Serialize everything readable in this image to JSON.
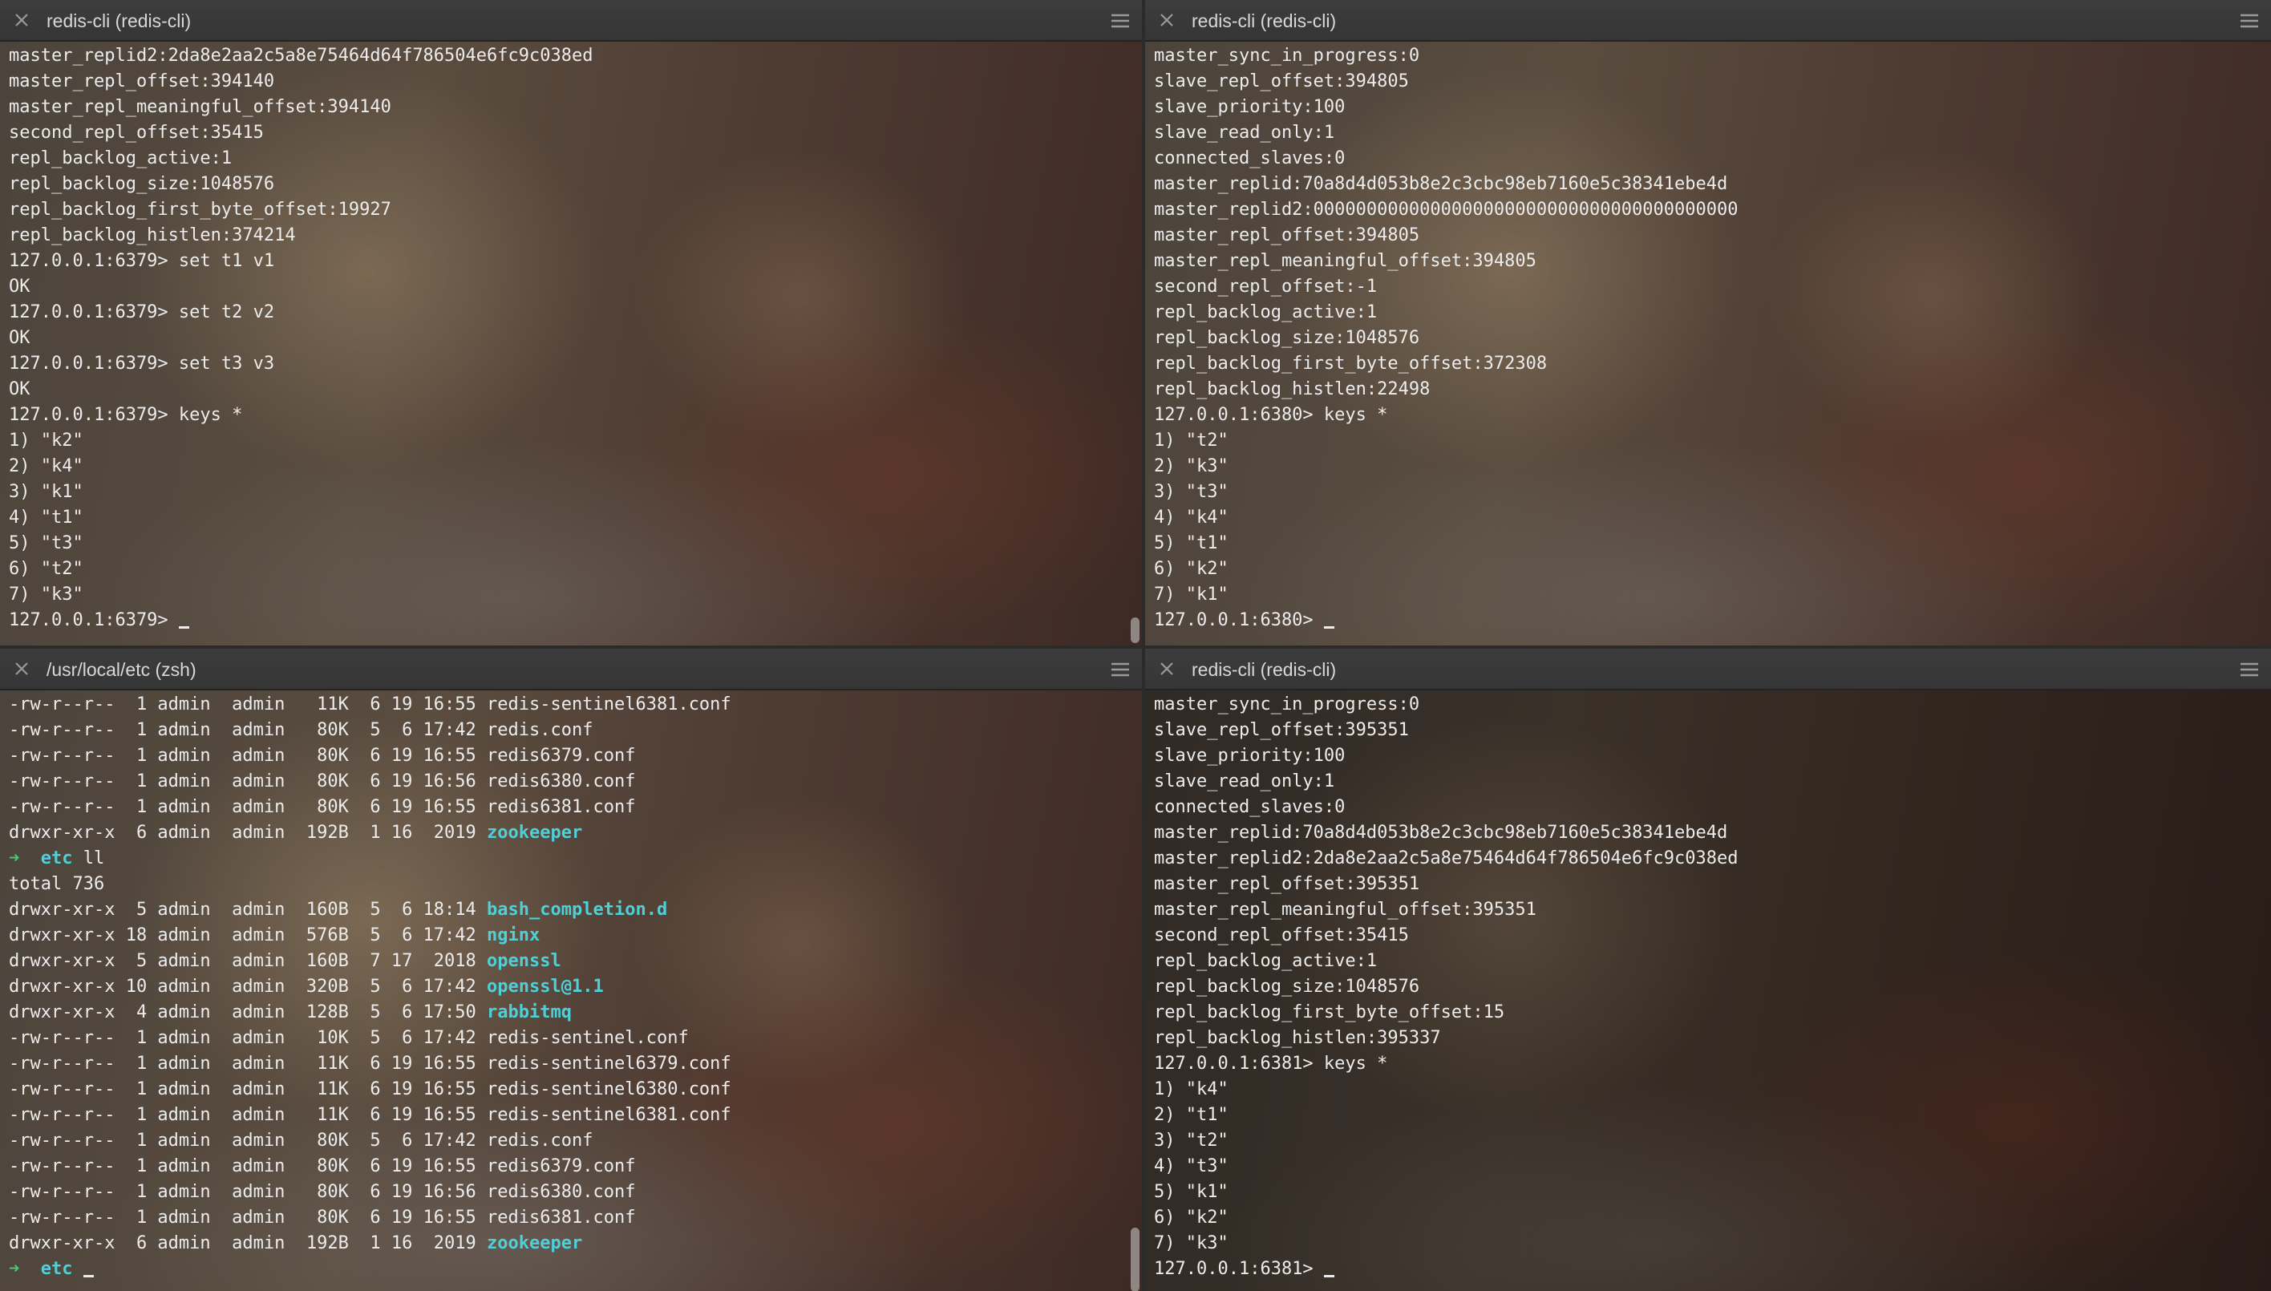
{
  "panes": {
    "top_left": {
      "title": "redis-cli (redis-cli)",
      "lines": [
        "master_replid2:2da8e2aa2c5a8e75464d64f786504e6fc9c038ed",
        "master_repl_offset:394140",
        "master_repl_meaningful_offset:394140",
        "second_repl_offset:35415",
        "repl_backlog_active:1",
        "repl_backlog_size:1048576",
        "repl_backlog_first_byte_offset:19927",
        "repl_backlog_histlen:374214",
        "127.0.0.1:6379> set t1 v1",
        "OK",
        "127.0.0.1:6379> set t2 v2",
        "OK",
        "127.0.0.1:6379> set t3 v3",
        "OK",
        "127.0.0.1:6379> keys *",
        "1) \"k2\"",
        "2) \"k4\"",
        "3) \"k1\"",
        "4) \"t1\"",
        "5) \"t3\"",
        "6) \"t2\"",
        "7) \"k3\""
      ],
      "prompt": "127.0.0.1:6379> "
    },
    "top_right": {
      "title": "redis-cli (redis-cli)",
      "lines": [
        "master_sync_in_progress:0",
        "slave_repl_offset:394805",
        "slave_priority:100",
        "slave_read_only:1",
        "connected_slaves:0",
        "master_replid:70a8d4d053b8e2c3cbc98eb7160e5c38341ebe4d",
        "master_replid2:0000000000000000000000000000000000000000",
        "master_repl_offset:394805",
        "master_repl_meaningful_offset:394805",
        "second_repl_offset:-1",
        "repl_backlog_active:1",
        "repl_backlog_size:1048576",
        "repl_backlog_first_byte_offset:372308",
        "repl_backlog_histlen:22498",
        "127.0.0.1:6380> keys *",
        "1) \"t2\"",
        "2) \"k3\"",
        "3) \"t3\"",
        "4) \"k4\"",
        "5) \"t1\"",
        "6) \"k2\"",
        "7) \"k1\""
      ],
      "prompt": "127.0.0.1:6380> "
    },
    "bottom_left": {
      "title": "/usr/local/etc (zsh)",
      "listing_a": [
        {
          "perm": "-rw-r--r--",
          "links": "1",
          "user": "admin",
          "group": "admin",
          "size": "11K",
          "month": "6",
          "day": "19",
          "time": "16:55",
          "name": "redis-sentinel6381.conf",
          "is_dir": false
        },
        {
          "perm": "-rw-r--r--",
          "links": "1",
          "user": "admin",
          "group": "admin",
          "size": "80K",
          "month": "5",
          "day": "6",
          "time": "17:42",
          "name": "redis.conf",
          "is_dir": false
        },
        {
          "perm": "-rw-r--r--",
          "links": "1",
          "user": "admin",
          "group": "admin",
          "size": "80K",
          "month": "6",
          "day": "19",
          "time": "16:55",
          "name": "redis6379.conf",
          "is_dir": false
        },
        {
          "perm": "-rw-r--r--",
          "links": "1",
          "user": "admin",
          "group": "admin",
          "size": "80K",
          "month": "6",
          "day": "19",
          "time": "16:56",
          "name": "redis6380.conf",
          "is_dir": false
        },
        {
          "perm": "-rw-r--r--",
          "links": "1",
          "user": "admin",
          "group": "admin",
          "size": "80K",
          "month": "6",
          "day": "19",
          "time": "16:55",
          "name": "redis6381.conf",
          "is_dir": false
        },
        {
          "perm": "drwxr-xr-x",
          "links": "6",
          "user": "admin",
          "group": "admin",
          "size": "192B",
          "month": "1",
          "day": "16",
          "time": " 2019",
          "name": "zookeeper",
          "is_dir": true
        }
      ],
      "prompt_arrow": "➜",
      "cwd": "etc",
      "command": "ll",
      "total": "total 736",
      "listing_b": [
        {
          "perm": "drwxr-xr-x",
          "links": "5",
          "user": "admin",
          "group": "admin",
          "size": "160B",
          "month": "5",
          "day": "6",
          "time": "18:14",
          "name": "bash_completion.d",
          "is_dir": true
        },
        {
          "perm": "drwxr-xr-x",
          "links": "18",
          "user": "admin",
          "group": "admin",
          "size": "576B",
          "month": "5",
          "day": "6",
          "time": "17:42",
          "name": "nginx",
          "is_dir": true
        },
        {
          "perm": "drwxr-xr-x",
          "links": "5",
          "user": "admin",
          "group": "admin",
          "size": "160B",
          "month": "7",
          "day": "17",
          "time": " 2018",
          "name": "openssl",
          "is_dir": true
        },
        {
          "perm": "drwxr-xr-x",
          "links": "10",
          "user": "admin",
          "group": "admin",
          "size": "320B",
          "month": "5",
          "day": "6",
          "time": "17:42",
          "name": "openssl@1.1",
          "is_dir": true
        },
        {
          "perm": "drwxr-xr-x",
          "links": "4",
          "user": "admin",
          "group": "admin",
          "size": "128B",
          "month": "5",
          "day": "6",
          "time": "17:50",
          "name": "rabbitmq",
          "is_dir": true
        },
        {
          "perm": "-rw-r--r--",
          "links": "1",
          "user": "admin",
          "group": "admin",
          "size": "10K",
          "month": "5",
          "day": "6",
          "time": "17:42",
          "name": "redis-sentinel.conf",
          "is_dir": false
        },
        {
          "perm": "-rw-r--r--",
          "links": "1",
          "user": "admin",
          "group": "admin",
          "size": "11K",
          "month": "6",
          "day": "19",
          "time": "16:55",
          "name": "redis-sentinel6379.conf",
          "is_dir": false
        },
        {
          "perm": "-rw-r--r--",
          "links": "1",
          "user": "admin",
          "group": "admin",
          "size": "11K",
          "month": "6",
          "day": "19",
          "time": "16:55",
          "name": "redis-sentinel6380.conf",
          "is_dir": false
        },
        {
          "perm": "-rw-r--r--",
          "links": "1",
          "user": "admin",
          "group": "admin",
          "size": "11K",
          "month": "6",
          "day": "19",
          "time": "16:55",
          "name": "redis-sentinel6381.conf",
          "is_dir": false
        },
        {
          "perm": "-rw-r--r--",
          "links": "1",
          "user": "admin",
          "group": "admin",
          "size": "80K",
          "month": "5",
          "day": "6",
          "time": "17:42",
          "name": "redis.conf",
          "is_dir": false
        },
        {
          "perm": "-rw-r--r--",
          "links": "1",
          "user": "admin",
          "group": "admin",
          "size": "80K",
          "month": "6",
          "day": "19",
          "time": "16:55",
          "name": "redis6379.conf",
          "is_dir": false
        },
        {
          "perm": "-rw-r--r--",
          "links": "1",
          "user": "admin",
          "group": "admin",
          "size": "80K",
          "month": "6",
          "day": "19",
          "time": "16:56",
          "name": "redis6380.conf",
          "is_dir": false
        },
        {
          "perm": "-rw-r--r--",
          "links": "1",
          "user": "admin",
          "group": "admin",
          "size": "80K",
          "month": "6",
          "day": "19",
          "time": "16:55",
          "name": "redis6381.conf",
          "is_dir": false
        },
        {
          "perm": "drwxr-xr-x",
          "links": "6",
          "user": "admin",
          "group": "admin",
          "size": "192B",
          "month": "1",
          "day": "16",
          "time": " 2019",
          "name": "zookeeper",
          "is_dir": true
        }
      ]
    },
    "bottom_right": {
      "title": "redis-cli (redis-cli)",
      "lines": [
        "master_sync_in_progress:0",
        "slave_repl_offset:395351",
        "slave_priority:100",
        "slave_read_only:1",
        "connected_slaves:0",
        "master_replid:70a8d4d053b8e2c3cbc98eb7160e5c38341ebe4d",
        "master_replid2:2da8e2aa2c5a8e75464d64f786504e6fc9c038ed",
        "master_repl_offset:395351",
        "master_repl_meaningful_offset:395351",
        "second_repl_offset:35415",
        "repl_backlog_active:1",
        "repl_backlog_size:1048576",
        "repl_backlog_first_byte_offset:15",
        "repl_backlog_histlen:395337",
        "127.0.0.1:6381> keys *",
        "1) \"k4\"",
        "2) \"t1\"",
        "3) \"t2\"",
        "4) \"t3\"",
        "5) \"k1\"",
        "6) \"k2\"",
        "7) \"k3\""
      ],
      "prompt": "127.0.0.1:6381> "
    }
  },
  "icons": {
    "close": "close-icon",
    "menu": "hamburger-menu-icon",
    "prompt_arrow": "prompt-arrow-icon"
  },
  "colors": {
    "directory": "#4ed0d8",
    "prompt_arrow": "#4ec76f",
    "text": "#ececec",
    "tab_bar": "#3a3a3a"
  }
}
